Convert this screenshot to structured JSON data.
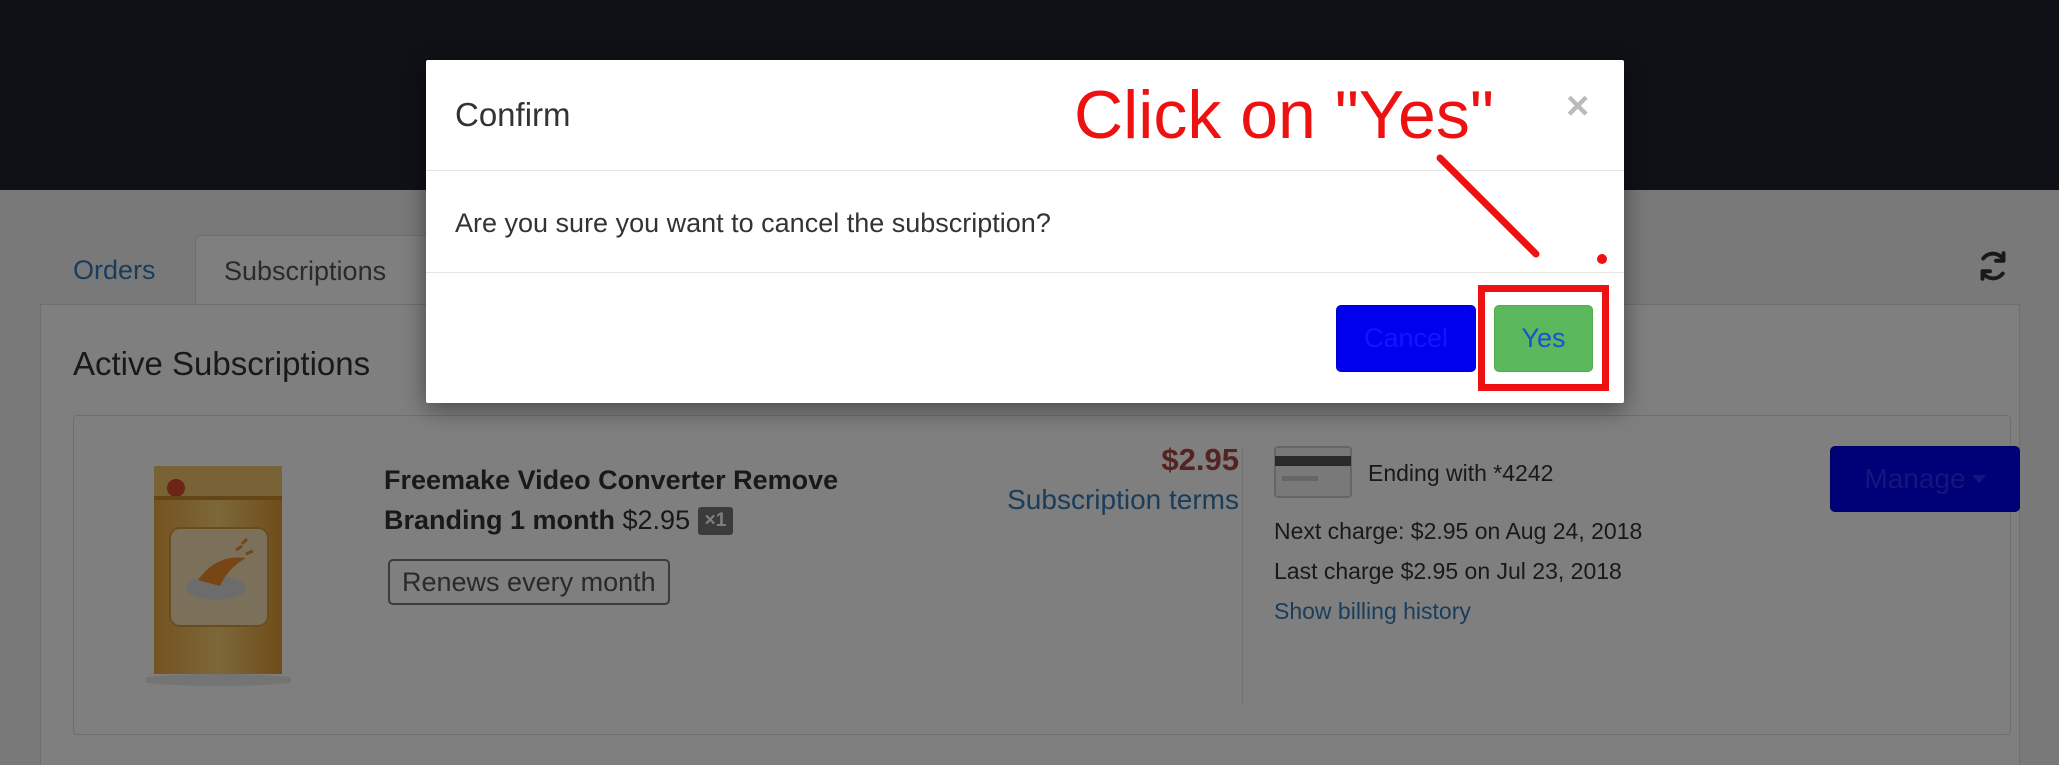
{
  "tabs": [
    {
      "label": "Orders",
      "active": false
    },
    {
      "label": "Subscriptions",
      "active": true
    }
  ],
  "icons": {
    "refresh": "refresh-icon",
    "card": "credit-card-icon",
    "product": "product-box-icon",
    "close": "close-icon",
    "caret": "caret-down-icon"
  },
  "page": {
    "section_title": "Active Subscriptions"
  },
  "subscription": {
    "product_name": "Freemake Video Converter Remove Branding 1 month",
    "unit_price": "$2.95",
    "quantity": "×1",
    "renewal": "Renews every month",
    "price": "$2.95",
    "terms_link": "Subscription terms",
    "card_ending": "Ending with *4242",
    "next_charge": "Next charge: $2.95 on Aug 24, 2018",
    "last_charge": "Last charge $2.95 on Jul 23, 2018",
    "billing_history_link": "Show billing history",
    "manage_label": "Manage"
  },
  "modal": {
    "title": "Confirm",
    "close_symbol": "×",
    "message": "Are you sure you want to cancel the subscription?",
    "cancel_label": "Cancel",
    "yes_label": "Yes"
  },
  "annotation": {
    "text": "Click on \"Yes\"",
    "color": "#ee1111"
  },
  "colors": {
    "topbar": "#1f232d",
    "link": "#337ab7",
    "price": "#a94442",
    "primary_button": "#0000ee",
    "yes_button": "#5cb85c"
  }
}
